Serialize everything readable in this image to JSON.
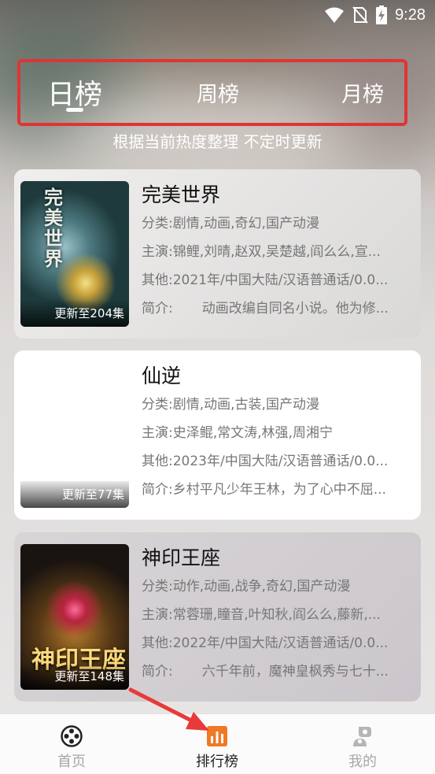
{
  "status_bar": {
    "time": "9:28"
  },
  "tabs": [
    {
      "label": "日榜",
      "selected": true
    },
    {
      "label": "周榜",
      "selected": false
    },
    {
      "label": "月榜",
      "selected": false
    }
  ],
  "subtitle": "根据当前热度整理 不定时更新",
  "items": [
    {
      "title": "完美世界",
      "poster_title": "完美世界",
      "episodes": "更新至204集",
      "rows": [
        {
          "key": "分类:",
          "value": "剧情,动画,奇幻,国产动漫"
        },
        {
          "key": "主演:",
          "value": "锦鲤,刘晴,赵双,吴楚越,阎么么,宣..."
        },
        {
          "key": "其他:",
          "value": "2021年/中国大陆/汉语普通话/0.0..."
        },
        {
          "key": "简介:",
          "value": "动画改编自同名小说。他为修..."
        }
      ]
    },
    {
      "title": "仙逆",
      "episodes": "更新至77集",
      "rows": [
        {
          "key": "分类:",
          "value": "剧情,动画,古装,国产动漫"
        },
        {
          "key": "主演:",
          "value": "史泽鲲,常文涛,林强,周湘宁"
        },
        {
          "key": "其他:",
          "value": "2023年/中国大陆/汉语普通话/0.0..."
        },
        {
          "key": "简介:",
          "value": "乡村平凡少年王林，为了心中不屈..."
        }
      ]
    },
    {
      "title": "神印王座",
      "poster_title": "神印王座",
      "episodes": "更新至148集",
      "rows": [
        {
          "key": "分类:",
          "value": "动作,动画,战争,奇幻,国产动漫"
        },
        {
          "key": "主演:",
          "value": "常蓉珊,瞳音,叶知秋,阎么么,藤新,..."
        },
        {
          "key": "其他:",
          "value": "2022年/中国大陆/汉语普通话/0.0..."
        },
        {
          "key": "简介:",
          "value": "六千年前，魔神皇枫秀与七十..."
        }
      ]
    }
  ],
  "bottom_nav": [
    {
      "label": "首页",
      "icon": "film-reel-icon",
      "active": false
    },
    {
      "label": "排行榜",
      "icon": "bar-chart-icon",
      "active": true
    },
    {
      "label": "我的",
      "icon": "profile-icon",
      "active": false
    }
  ],
  "colors": {
    "highlight_border": "#e03434",
    "rank_icon": "#f07a24",
    "arrow": "#e83a3a"
  }
}
